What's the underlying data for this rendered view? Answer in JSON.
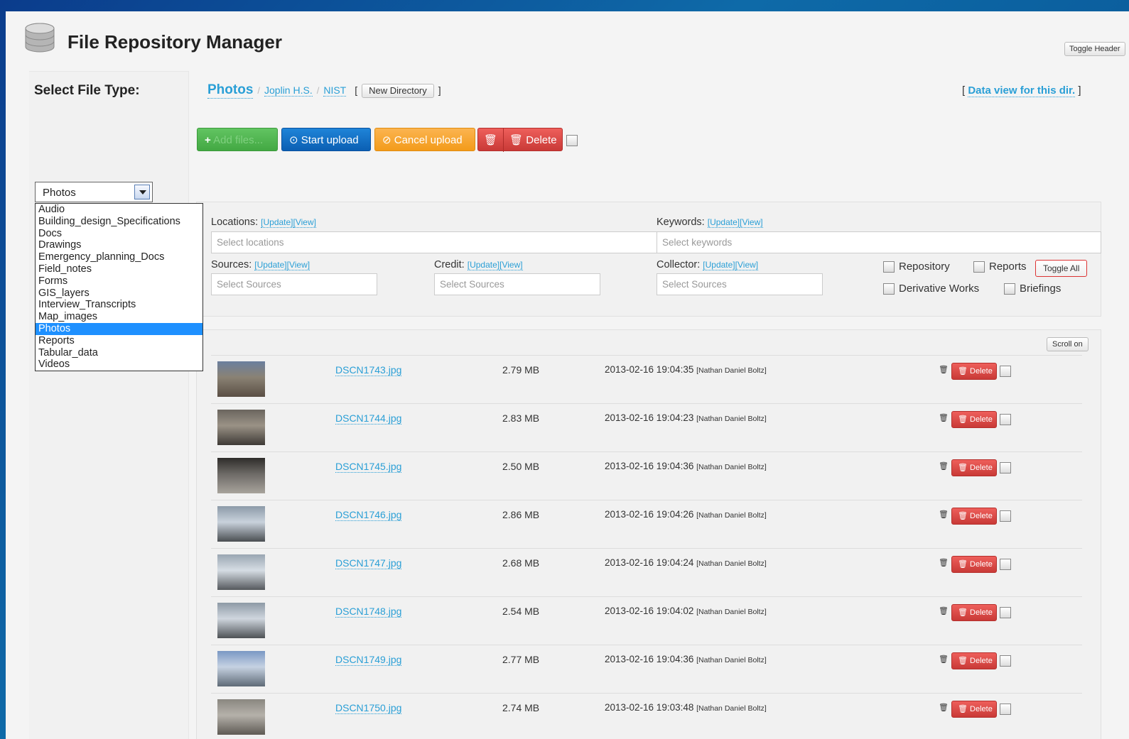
{
  "app": {
    "title": "File Repository Manager",
    "toggle_header": "Toggle Header"
  },
  "sidebar": {
    "label": "Select File Type:",
    "selected": "Photos",
    "options": [
      "Audio",
      "Building_design_Specifications",
      "Docs",
      "Drawings",
      "Emergency_planning_Docs",
      "Field_notes",
      "Forms",
      "GIS_layers",
      "Interview_Transcripts",
      "Map_images",
      "Photos",
      "Reports",
      "Tabular_data",
      "Videos"
    ]
  },
  "breadcrumb": {
    "current": "Photos",
    "path": [
      "Joplin H.S.",
      "NIST"
    ],
    "open_bracket": "[",
    "close_bracket": "]",
    "new_directory": "New Directory"
  },
  "data_view": {
    "open": "[ ",
    "link": "Data view for this dir.",
    "close": " ]"
  },
  "toolbar": {
    "add_files": "Add files...",
    "start_upload": "Start upload",
    "cancel_upload": "Cancel upload",
    "delete": "Delete"
  },
  "filters": {
    "update": "[Update]",
    "view": "[View]",
    "locations": {
      "label": "Locations:",
      "placeholder": "Select locations"
    },
    "keywords": {
      "label": "Keywords:",
      "placeholder": "Select keywords"
    },
    "sources": {
      "label": "Sources:",
      "placeholder": "Select Sources"
    },
    "credit": {
      "label": "Credit:",
      "placeholder": "Select Sources"
    },
    "collector": {
      "label": "Collector:",
      "placeholder": "Select Sources"
    },
    "checks": [
      "Repository",
      "Reports",
      "Derivative Works",
      "Briefings"
    ],
    "toggle_all": "Toggle All"
  },
  "files_panel": {
    "scroll_on": "Scroll on",
    "delete_label": "Delete",
    "rows": [
      {
        "name": "DSCN1743.jpg",
        "size": "2.79 MB",
        "date": "2013-02-16 19:04:35",
        "who": "[Nathan Daniel Boltz]"
      },
      {
        "name": "DSCN1744.jpg",
        "size": "2.83 MB",
        "date": "2013-02-16 19:04:23",
        "who": "[Nathan Daniel Boltz]"
      },
      {
        "name": "DSCN1745.jpg",
        "size": "2.50 MB",
        "date": "2013-02-16 19:04:36",
        "who": "[Nathan Daniel Boltz]"
      },
      {
        "name": "DSCN1746.jpg",
        "size": "2.86 MB",
        "date": "2013-02-16 19:04:26",
        "who": "[Nathan Daniel Boltz]"
      },
      {
        "name": "DSCN1747.jpg",
        "size": "2.68 MB",
        "date": "2013-02-16 19:04:24",
        "who": "[Nathan Daniel Boltz]"
      },
      {
        "name": "DSCN1748.jpg",
        "size": "2.54 MB",
        "date": "2013-02-16 19:04:02",
        "who": "[Nathan Daniel Boltz]"
      },
      {
        "name": "DSCN1749.jpg",
        "size": "2.77 MB",
        "date": "2013-02-16 19:04:36",
        "who": "[Nathan Daniel Boltz]"
      },
      {
        "name": "DSCN1750.jpg",
        "size": "2.74 MB",
        "date": "2013-02-16 19:03:48",
        "who": "[Nathan Daniel Boltz]"
      }
    ]
  }
}
